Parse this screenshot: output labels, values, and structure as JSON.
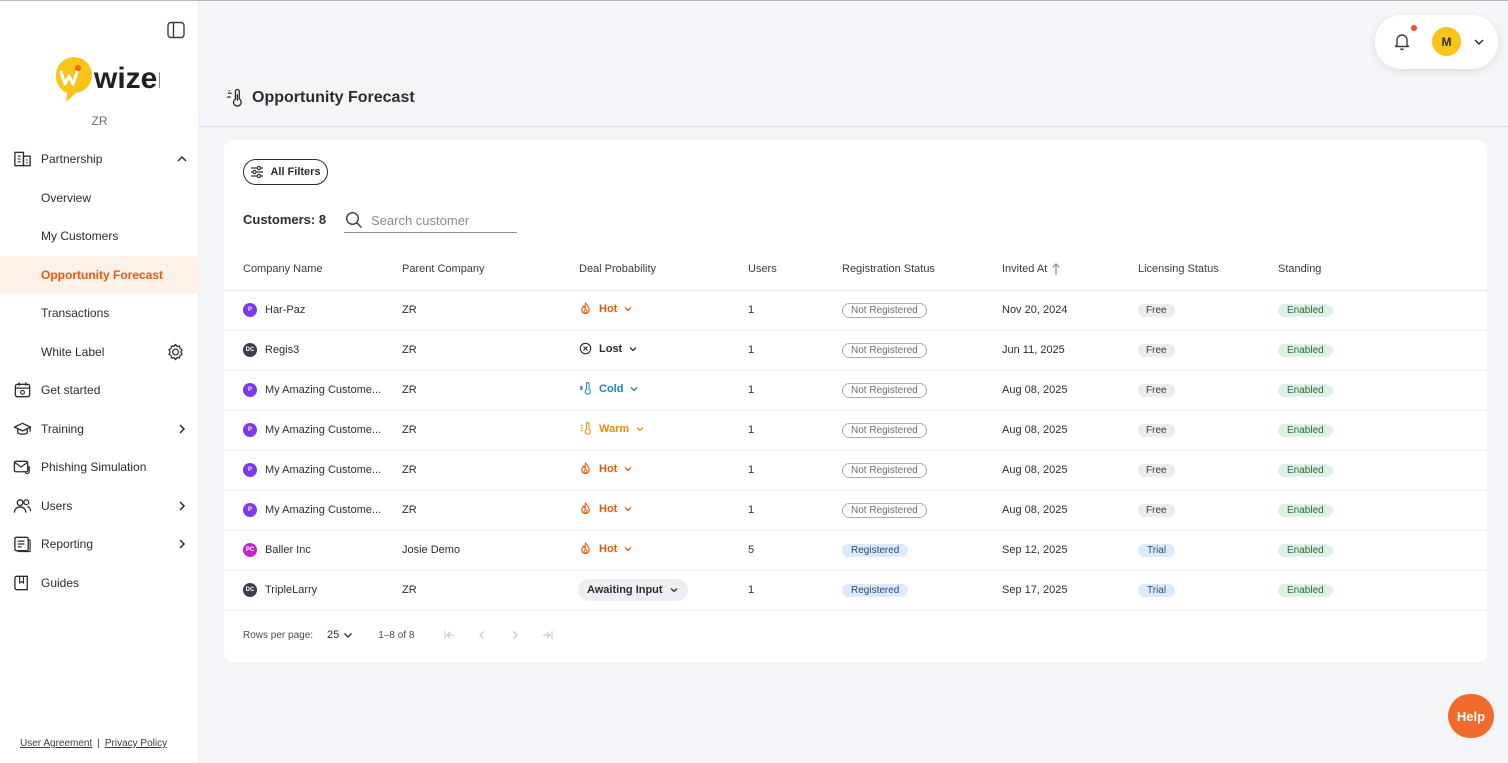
{
  "brand": {
    "logo_text": "wizer",
    "org_code": "ZR",
    "accent_color": "#e8590c",
    "logo_color": "#fcc419"
  },
  "sidebar": {
    "items": [
      {
        "label": "Partnership",
        "icon": "building-icon"
      },
      {
        "label": "Overview"
      },
      {
        "label": "My Customers"
      },
      {
        "label": "Opportunity Forecast"
      },
      {
        "label": "Transactions"
      },
      {
        "label": "White Label",
        "icon": "gear-icon"
      },
      {
        "label": "Get started",
        "icon": "calendar-icon"
      },
      {
        "label": "Training",
        "icon": "graduation-cap-icon"
      },
      {
        "label": "Phishing Simulation",
        "icon": "mail-hook-icon"
      },
      {
        "label": "Users",
        "icon": "users-icon"
      },
      {
        "label": "Reporting",
        "icon": "report-icon"
      },
      {
        "label": "Guides",
        "icon": "book-icon"
      }
    ],
    "footer": {
      "user_agreement": "User Agreement",
      "separator": "|",
      "privacy_policy": "Privacy Policy"
    }
  },
  "header": {
    "page_title": "Opportunity Forecast",
    "avatar_initial": "M"
  },
  "filters": {
    "all_filters_label": "All Filters"
  },
  "customers": {
    "count_label": "Customers: 8",
    "search_placeholder": "Search customer"
  },
  "table": {
    "columns": [
      "Company Name",
      "Parent Company",
      "Deal Probability",
      "Users",
      "Registration Status",
      "Invited At",
      "Licensing Status",
      "Standing"
    ],
    "rows": [
      {
        "badge": "P",
        "badge_color": "#7c3aed",
        "company": "Har-Paz",
        "parent": "ZR",
        "probability": "Hot",
        "users": "1",
        "registration": "Not Registered",
        "invited": "Nov 20, 2024",
        "licensing": "Free",
        "standing": "Enabled"
      },
      {
        "badge": "DC",
        "badge_color": "#3b3f4a",
        "company": "Regis3",
        "parent": "ZR",
        "probability": "Lost",
        "users": "1",
        "registration": "Not Registered",
        "invited": "Jun 11, 2025",
        "licensing": "Free",
        "standing": "Enabled"
      },
      {
        "badge": "P",
        "badge_color": "#7c3aed",
        "company": "My Amazing Custome...",
        "parent": "ZR",
        "probability": "Cold",
        "users": "1",
        "registration": "Not Registered",
        "invited": "Aug 08, 2025",
        "licensing": "Free",
        "standing": "Enabled"
      },
      {
        "badge": "P",
        "badge_color": "#7c3aed",
        "company": "My Amazing Custome...",
        "parent": "ZR",
        "probability": "Warm",
        "users": "1",
        "registration": "Not Registered",
        "invited": "Aug 08, 2025",
        "licensing": "Free",
        "standing": "Enabled"
      },
      {
        "badge": "P",
        "badge_color": "#7c3aed",
        "company": "My Amazing Custome...",
        "parent": "ZR",
        "probability": "Hot",
        "users": "1",
        "registration": "Not Registered",
        "invited": "Aug 08, 2025",
        "licensing": "Free",
        "standing": "Enabled"
      },
      {
        "badge": "P",
        "badge_color": "#7c3aed",
        "company": "My Amazing Custome...",
        "parent": "ZR",
        "probability": "Hot",
        "users": "1",
        "registration": "Not Registered",
        "invited": "Aug 08, 2025",
        "licensing": "Free",
        "standing": "Enabled"
      },
      {
        "badge": "PC",
        "badge_color": "#c026d3",
        "company": "Baller Inc",
        "parent": "Josie Demo",
        "probability": "Hot",
        "users": "5",
        "registration": "Registered",
        "invited": "Sep 12, 2025",
        "licensing": "Trial",
        "standing": "Enabled"
      },
      {
        "badge": "DC",
        "badge_color": "#3b3f4a",
        "company": "TripleLarry",
        "parent": "ZR",
        "probability": "Awaiting Input",
        "users": "1",
        "registration": "Registered",
        "invited": "Sep 17, 2025",
        "licensing": "Trial",
        "standing": "Enabled"
      }
    ]
  },
  "pagination": {
    "rows_per_page_label": "Rows per page:",
    "rows_per_page_value": "25",
    "range": "1–8 of 8"
  },
  "help": {
    "label": "Help"
  },
  "probability_colors": {
    "Hot": "#e8590c",
    "Warm": "#f08c00",
    "Cold": "#1c7ed6",
    "Lost": "#2b2d33",
    "Awaiting Input": "#2b2d33"
  }
}
